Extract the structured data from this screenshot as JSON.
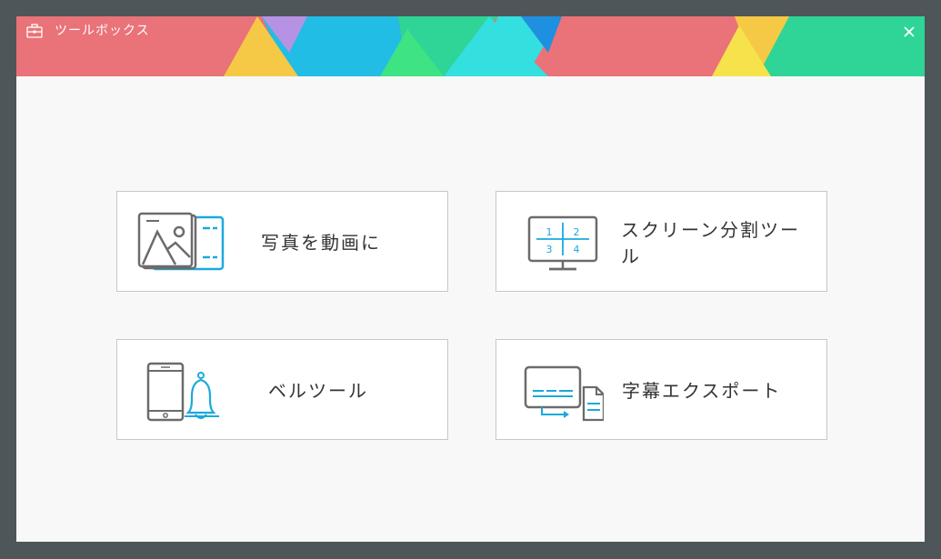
{
  "window": {
    "title": "ツールボックス",
    "close_label": "×",
    "colors": {
      "coral": "#ea7279",
      "yellow": "#f5c945",
      "purple": "#b592e3",
      "cyan": "#21bde4",
      "green": "#31d993",
      "teal": "#34dfdf",
      "blue": "#1f8fe0",
      "lightgreen": "#3ee384",
      "lightyellow": "#f6e24a"
    }
  },
  "tools": [
    {
      "label": "写真を動画に",
      "icon": "photo-to-video-icon"
    },
    {
      "label": "スクリーン分割ツール",
      "icon": "split-screen-icon"
    },
    {
      "label": "ベルツール",
      "icon": "phone-bell-icon"
    },
    {
      "label": "字幕エクスポート",
      "icon": "subtitle-export-icon"
    }
  ],
  "split_icon_numbers": [
    "1",
    "2",
    "3",
    "4"
  ],
  "accent_color": "#1aa9dc"
}
